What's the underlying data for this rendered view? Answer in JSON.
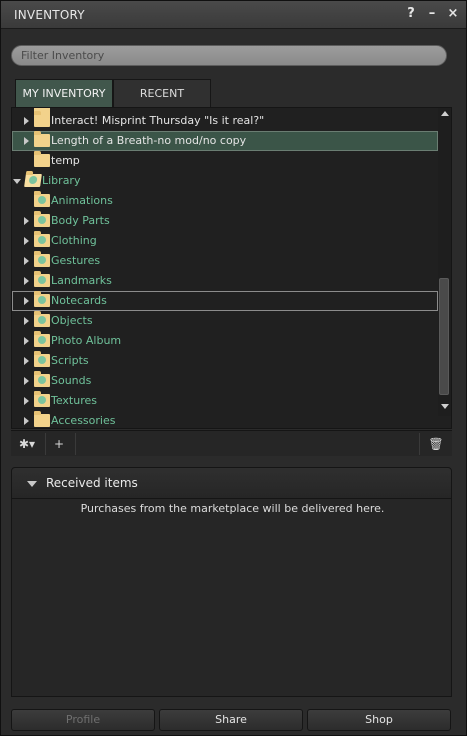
{
  "window": {
    "title": "INVENTORY",
    "icons": [
      "help-icon",
      "minimize-icon",
      "close-icon"
    ],
    "help_glyph": "?",
    "minimize_glyph": "–",
    "close_glyph": "×"
  },
  "filter": {
    "placeholder": "Filter Inventory"
  },
  "tabs": [
    {
      "label": "MY INVENTORY",
      "active": true
    },
    {
      "label": "RECENT",
      "active": false
    }
  ],
  "tree": {
    "items": [
      {
        "label": "Interact! Misprint Thursday \"Is it real?\"",
        "expandable": true,
        "kind": "folder"
      },
      {
        "label": "Length of a Breath-no mod/no copy",
        "expandable": true,
        "kind": "folder",
        "selected": true
      },
      {
        "label": "temp",
        "expandable": false,
        "kind": "folder"
      },
      {
        "label": "Library",
        "expandable": true,
        "expanded": true,
        "kind": "library-root"
      },
      {
        "label": "Animations",
        "expandable": false,
        "kind": "system-folder"
      },
      {
        "label": "Body Parts",
        "expandable": true,
        "kind": "system-folder"
      },
      {
        "label": "Clothing",
        "expandable": true,
        "kind": "system-folder"
      },
      {
        "label": "Gestures",
        "expandable": true,
        "kind": "system-folder"
      },
      {
        "label": "Landmarks",
        "expandable": true,
        "kind": "system-folder"
      },
      {
        "label": "Notecards",
        "expandable": true,
        "kind": "system-folder",
        "hovered": true
      },
      {
        "label": "Objects",
        "expandable": true,
        "kind": "system-folder"
      },
      {
        "label": "Photo Album",
        "expandable": true,
        "kind": "system-folder"
      },
      {
        "label": "Scripts",
        "expandable": true,
        "kind": "system-folder"
      },
      {
        "label": "Sounds",
        "expandable": true,
        "kind": "system-folder"
      },
      {
        "label": "Textures",
        "expandable": true,
        "kind": "system-folder"
      },
      {
        "label": "Accessories",
        "expandable": true,
        "kind": "folder"
      }
    ]
  },
  "toolbar": {
    "gear_glyph": "✱▾",
    "add_glyph": "+",
    "trash_glyph": "🗑"
  },
  "received": {
    "title": "Received items",
    "message": "Purchases from the marketplace will be delivered here."
  },
  "buttons": {
    "profile": "Profile",
    "share": "Share",
    "shop": "Shop"
  },
  "colors": {
    "selected_row": "#3b5548",
    "library_text": "#6fc19a",
    "active_tab": "#41574c"
  }
}
